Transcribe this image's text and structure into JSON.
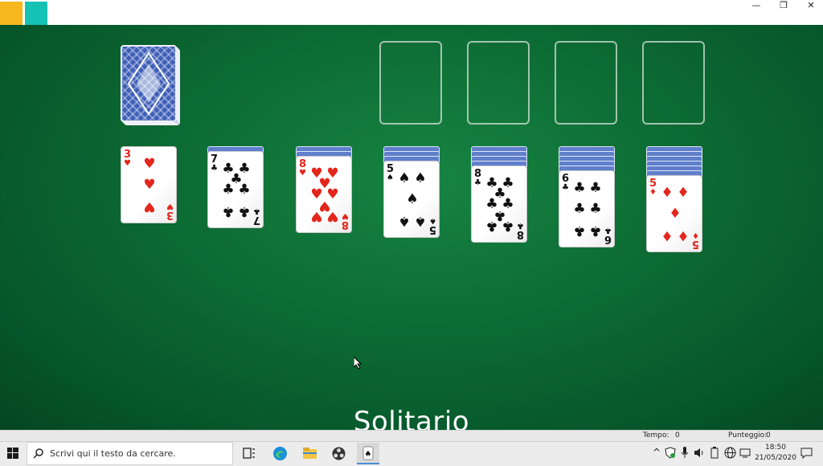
{
  "window": {
    "minimize_glyph": "—",
    "restore_glyph": "❐",
    "close_glyph": "✕"
  },
  "tiles": {
    "colors": [
      "#f6b81c",
      "#16c2b4",
      "#b183d6",
      "#f0555a"
    ]
  },
  "felt_color": "#0c6a33",
  "stock": {
    "face": "down"
  },
  "foundations": {
    "count": 4
  },
  "tableau": [
    {
      "hidden": 0,
      "rank": "3",
      "suit": "♥",
      "color": "red"
    },
    {
      "hidden": 1,
      "rank": "7",
      "suit": "♣",
      "color": "black"
    },
    {
      "hidden": 2,
      "rank": "8",
      "suit": "♥",
      "color": "red"
    },
    {
      "hidden": 3,
      "rank": "5",
      "suit": "♠",
      "color": "black"
    },
    {
      "hidden": 4,
      "rank": "8",
      "suit": "♣",
      "color": "black"
    },
    {
      "hidden": 5,
      "rank": "6",
      "suit": "♣",
      "color": "black"
    },
    {
      "hidden": 6,
      "rank": "5",
      "suit": "♦",
      "color": "red"
    }
  ],
  "splash_title": "Solitario",
  "status": {
    "time_label": "Tempo:",
    "time_value": "0",
    "score_label": "Punteggio:",
    "score_value": "0"
  },
  "taskbar": {
    "search_placeholder": "Scrivi qui il testo da cercare.",
    "clock_time": "18:50",
    "clock_date": "21/05/2020",
    "tray_chevron": "^"
  }
}
